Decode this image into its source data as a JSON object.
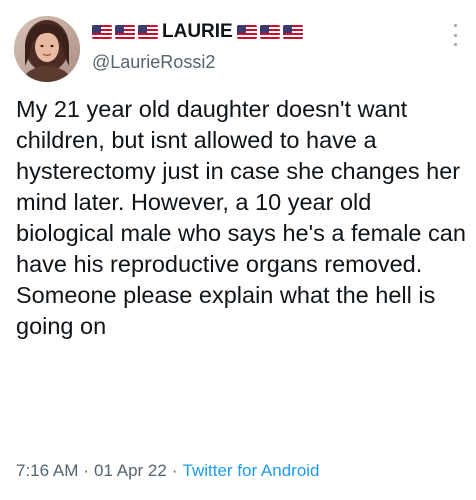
{
  "tweet": {
    "display_name": "LAURIE",
    "flags_left": [
      "us-flag",
      "us-flag",
      "us-flag"
    ],
    "flags_right": [
      "us-flag",
      "us-flag",
      "us-flag"
    ],
    "handle": "@LaurieRossi2",
    "text": "My 21 year old daughter doesn't want children, but isnt allowed to have a hysterectomy just in case she changes her mind later. However, a 10 year old biological male who says he's a female can have his reproductive organs removed.\nSomeone please explain what the hell is going on",
    "time": "7:16 AM",
    "separator": "·",
    "date": "01 Apr 22",
    "source": "Twitter for Android"
  },
  "colors": {
    "text": "#0f1419",
    "secondary": "#536471",
    "link": "#1d9bf0",
    "flag_red": "#c8102e",
    "flag_blue": "#3c3b6e"
  }
}
